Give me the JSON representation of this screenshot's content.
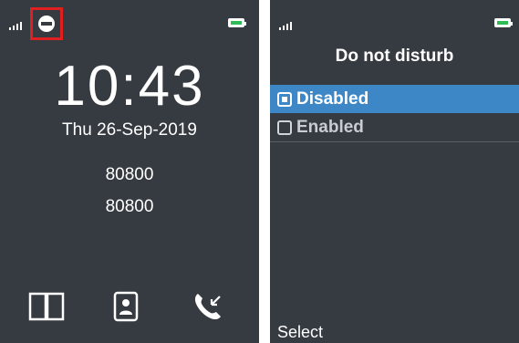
{
  "left_screen": {
    "status": {
      "signal_icon": "signal-bars-icon",
      "dnd_icon": "do-not-disturb-icon",
      "battery_icon": "battery-icon",
      "battery_color": "#2fbb55",
      "highlight_color": "#e02020"
    },
    "clock": "10:43",
    "date": "Thu 26-Sep-2019",
    "numbers": [
      "80800",
      "80800"
    ],
    "softkeys": [
      {
        "icon": "phonebook-icon"
      },
      {
        "icon": "contact-card-icon"
      },
      {
        "icon": "call-log-icon"
      }
    ]
  },
  "right_screen": {
    "status": {
      "signal_icon": "signal-bars-icon",
      "battery_icon": "battery-icon"
    },
    "title": "Do not disturb",
    "options": [
      {
        "label": "Disabled",
        "selected": true
      },
      {
        "label": "Enabled",
        "selected": false
      }
    ],
    "selected_color": "#3d87c7",
    "softkey_label": "Select"
  },
  "background_color": "#363b42"
}
